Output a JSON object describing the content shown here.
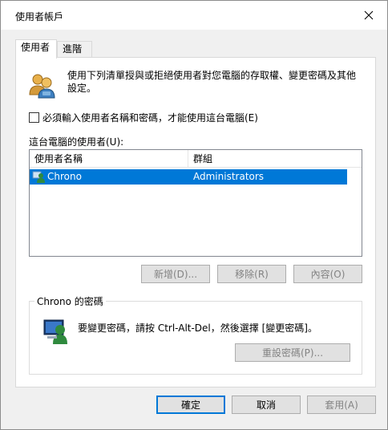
{
  "window": {
    "title": "使用者帳戶"
  },
  "tabs": [
    {
      "label": "使用者",
      "active": true
    },
    {
      "label": "進階",
      "active": false
    }
  ],
  "users_tab": {
    "info_text": "使用下列清單授與或拒絕使用者對您電腦的存取權、變更密碼及其他設定。",
    "checkbox_label": "必須輸入使用者名稱和密碼，才能使用這台電腦(E)",
    "checkbox_checked": false,
    "list_label": "這台電腦的使用者(U):",
    "columns": [
      "使用者名稱",
      "群組"
    ],
    "rows": [
      {
        "name": "Chrono",
        "group": "Administrators",
        "selected": true
      }
    ],
    "buttons": {
      "add": "新增(D)...",
      "remove": "移除(R)",
      "properties": "內容(O)"
    },
    "password_group": {
      "title": "Chrono 的密碼",
      "text": "要變更密碼，請按 Ctrl-Alt-Del，然後選擇 [變更密碼]。",
      "reset_button": "重設密碼(P)..."
    }
  },
  "dialog_buttons": {
    "ok": "確定",
    "cancel": "取消",
    "apply": "套用(A)"
  },
  "colors": {
    "selection": "#0078d7",
    "panel": "#ffffff",
    "window": "#f0f0f0"
  },
  "icons": {
    "close": "close-icon",
    "users": "users-icon",
    "user_row": "user-icon",
    "password": "password-icon"
  }
}
